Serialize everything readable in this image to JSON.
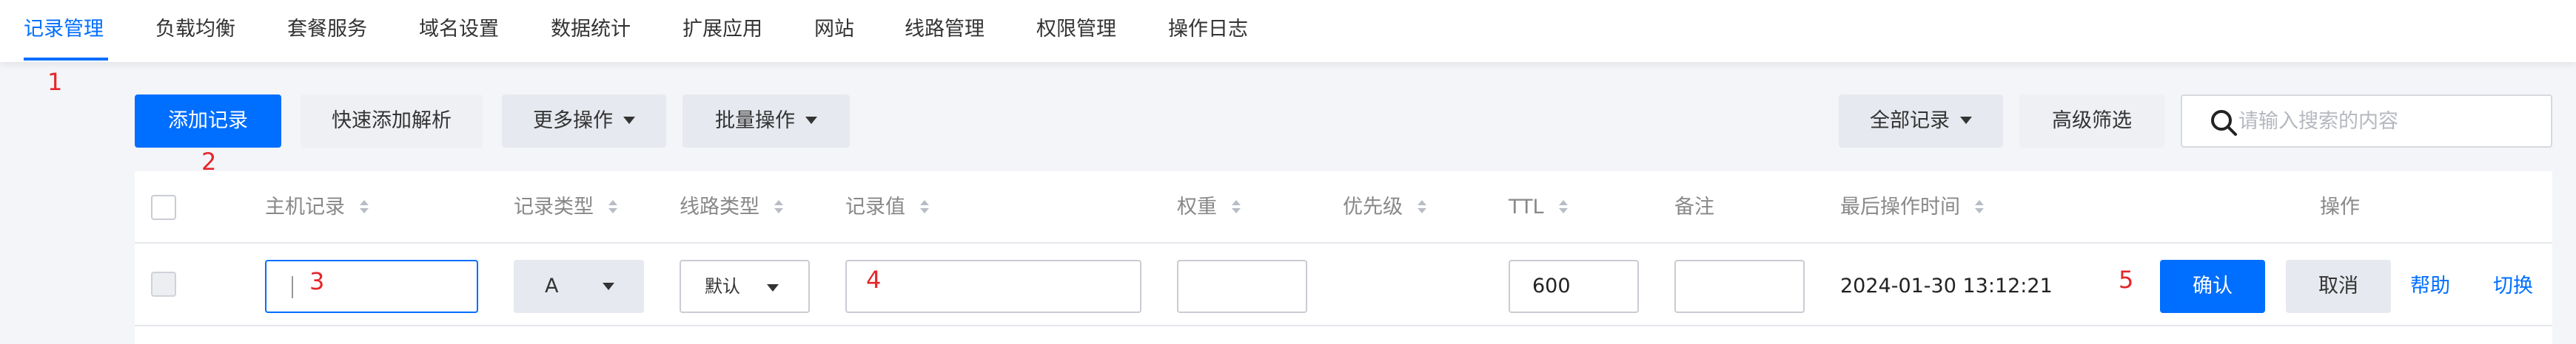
{
  "nav": {
    "items": [
      {
        "label": "记录管理",
        "active": true
      },
      {
        "label": "负载均衡"
      },
      {
        "label": "套餐服务"
      },
      {
        "label": "域名设置"
      },
      {
        "label": "数据统计"
      },
      {
        "label": "扩展应用"
      },
      {
        "label": "网站"
      },
      {
        "label": "线路管理"
      },
      {
        "label": "权限管理"
      },
      {
        "label": "操作日志"
      }
    ]
  },
  "annotations": [
    "1",
    "2",
    "3",
    "4",
    "5"
  ],
  "toolbar": {
    "add_record": "添加记录",
    "quick_add": "快速添加解析",
    "more_actions": "更多操作",
    "batch_actions": "批量操作",
    "all_records": "全部记录",
    "advanced_filter": "高级筛选",
    "search_placeholder": "请输入搜索的内容"
  },
  "table": {
    "columns": [
      "主机记录",
      "记录类型",
      "线路类型",
      "记录值",
      "权重",
      "优先级",
      "TTL",
      "备注",
      "最后操作时间",
      "操作"
    ],
    "edit_row": {
      "host": "",
      "record_type": "A",
      "line_type": "默认",
      "value": "",
      "weight": "",
      "ttl": "600",
      "remark": "",
      "last_modified": "2024-01-30 13:12:21",
      "confirm": "确认",
      "cancel": "取消",
      "help": "帮助",
      "switch": "切换"
    }
  },
  "colors": {
    "accent": "#006eff",
    "annotation": "#e5262a"
  }
}
